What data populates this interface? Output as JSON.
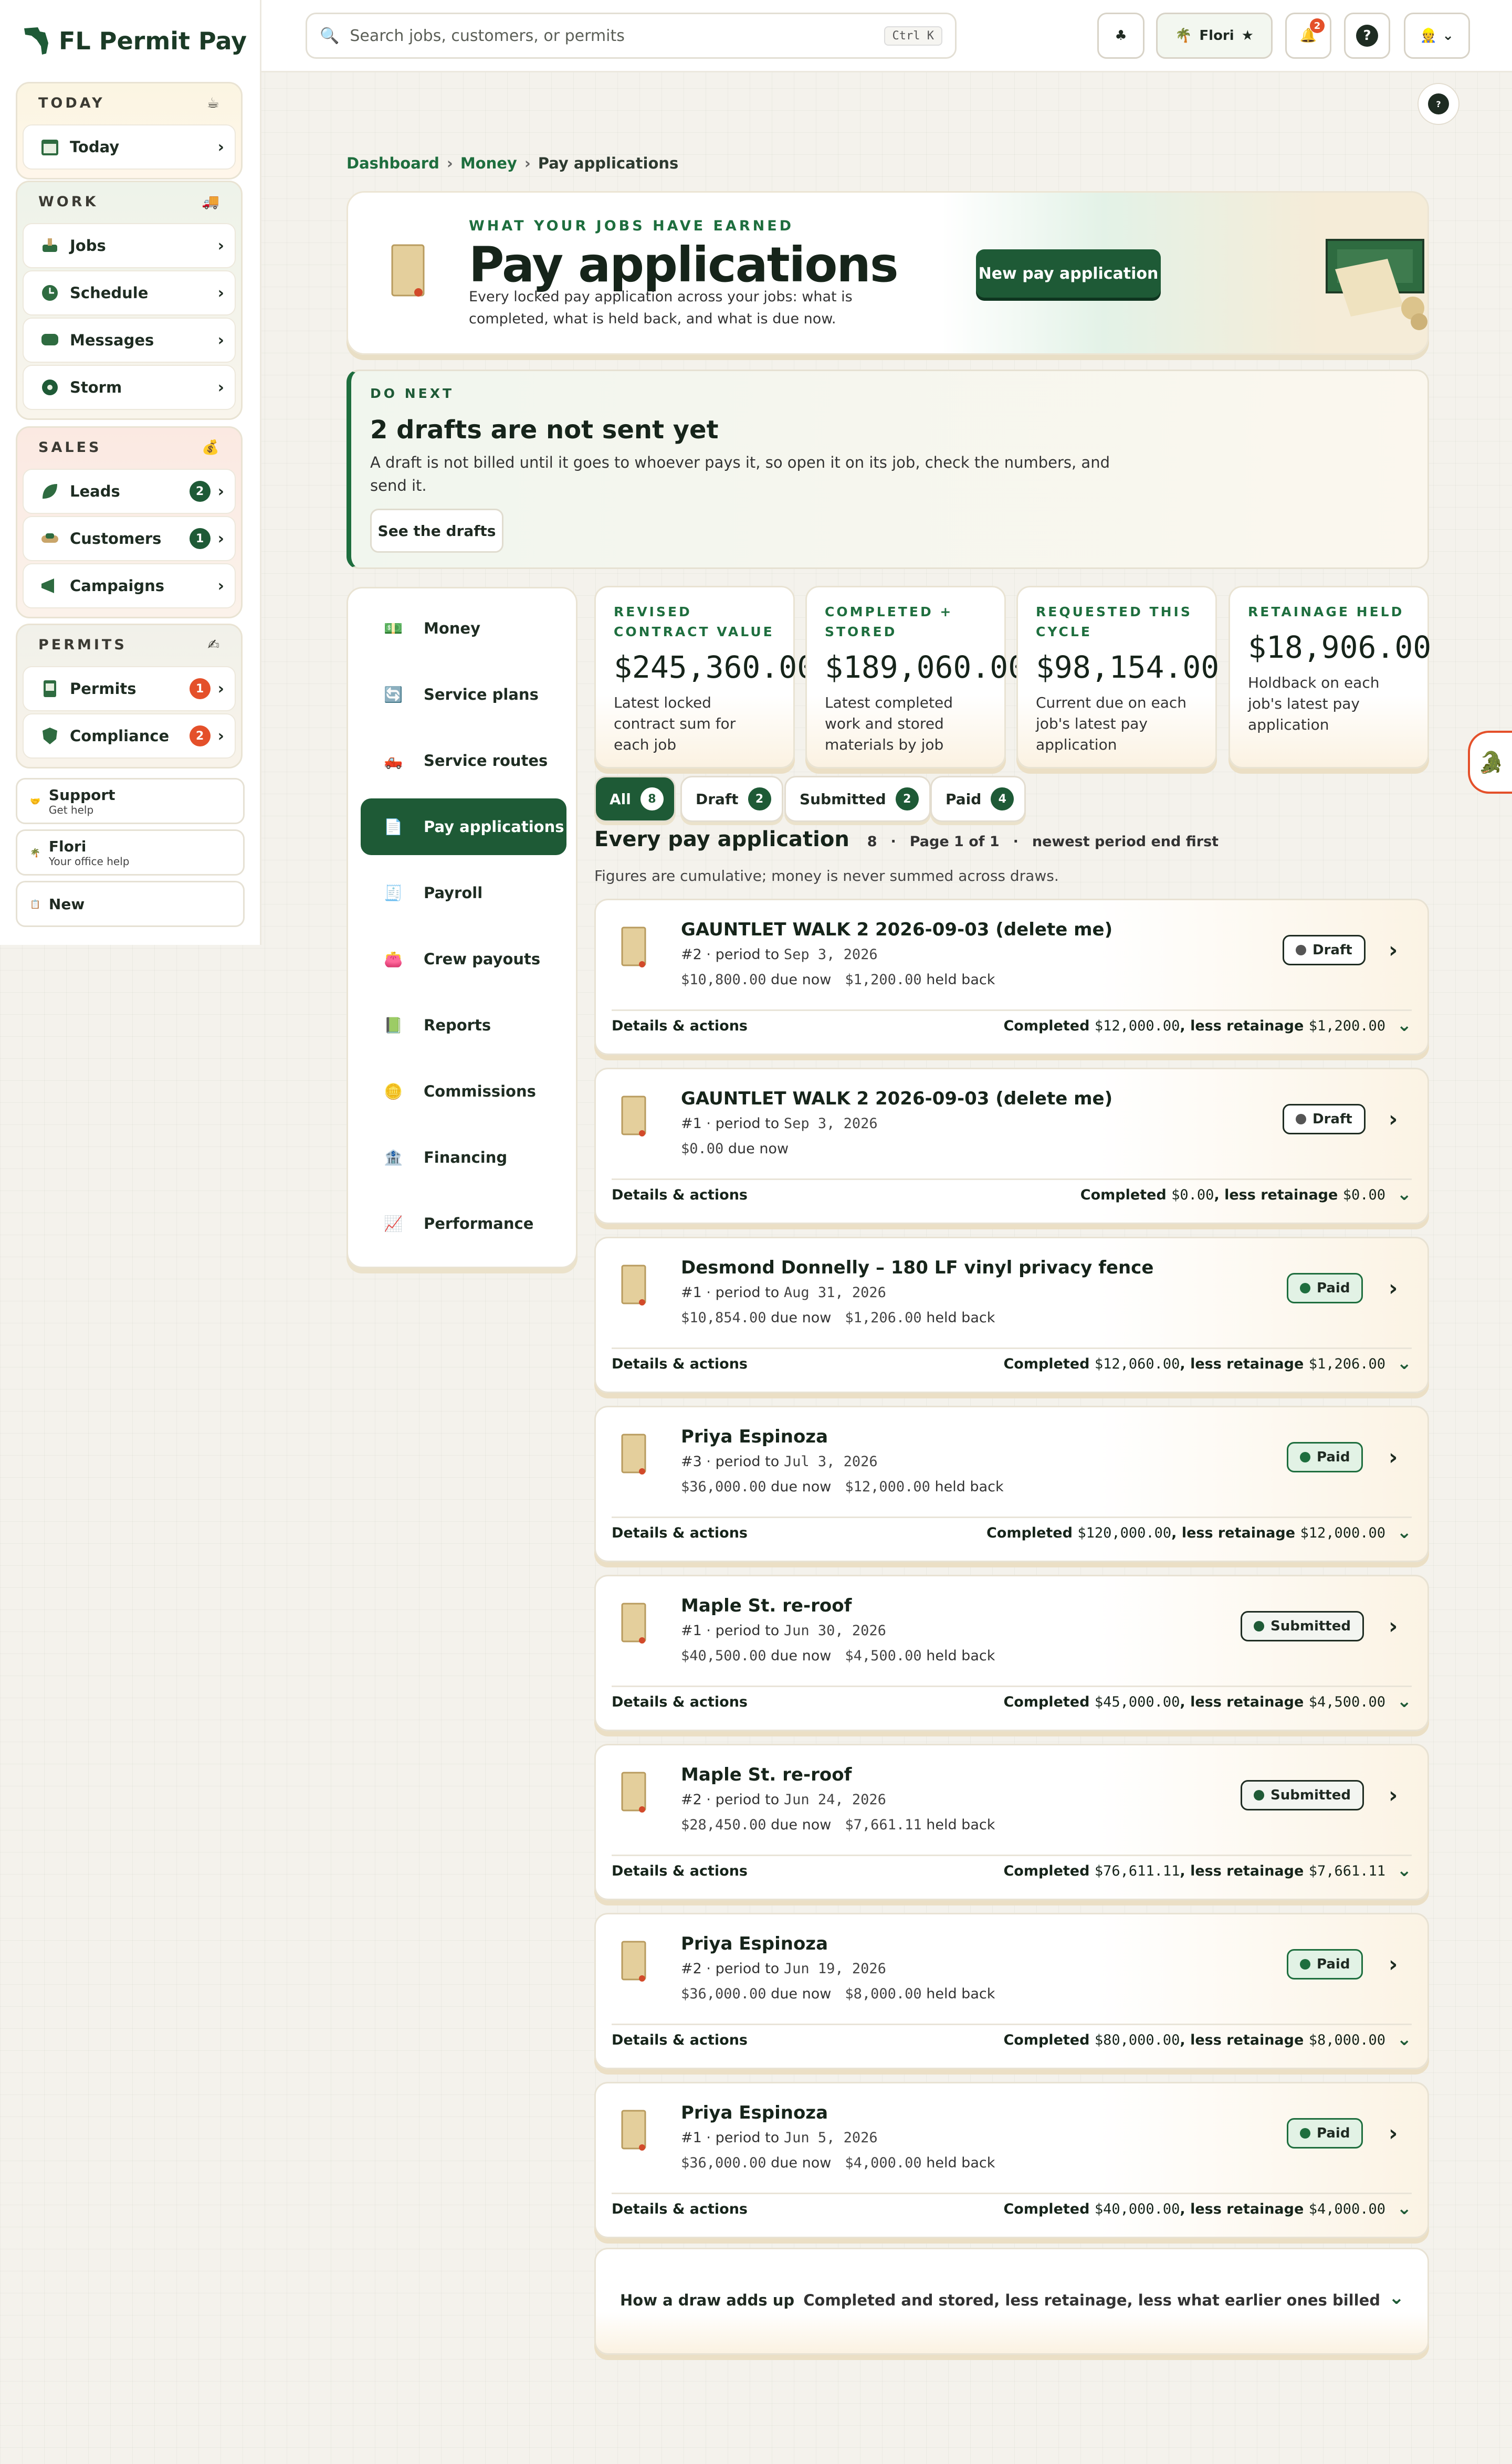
{
  "app": {
    "name": "FL Permit Pay"
  },
  "sidebar": {
    "groups": [
      {
        "title": "TODAY",
        "items": [
          {
            "label": "Today"
          }
        ]
      },
      {
        "title": "WORK",
        "items": [
          {
            "label": "Jobs"
          },
          {
            "label": "Schedule"
          },
          {
            "label": "Messages"
          },
          {
            "label": "Storm"
          }
        ]
      },
      {
        "title": "SALES",
        "items": [
          {
            "label": "Leads",
            "badge": "2"
          },
          {
            "label": "Customers",
            "badge": "1"
          },
          {
            "label": "Campaigns"
          }
        ]
      },
      {
        "title": "PERMITS",
        "items": [
          {
            "label": "Permits",
            "badge": "1"
          },
          {
            "label": "Compliance",
            "badge": "2"
          }
        ]
      }
    ],
    "support": {
      "title": "Support",
      "sub": "Get help"
    },
    "assistant": {
      "title": "Flori",
      "sub": "Your office help"
    },
    "new": {
      "label": "New"
    }
  },
  "topbar": {
    "search_placeholder": "Search jobs, customers, or permits",
    "shortcut": "Ctrl K",
    "flori_label": "Flori",
    "notif_count": "2",
    "help": "?"
  },
  "breadcrumb": {
    "items": [
      "Dashboard",
      "Money",
      "Pay applications"
    ],
    "sep": "›"
  },
  "hero": {
    "eyebrow": "WHAT YOUR JOBS HAVE EARNED",
    "title": "Pay applications",
    "desc": "Every locked pay application across your jobs: what is completed, what is held back, and what is due now.",
    "button": "New pay application"
  },
  "donext": {
    "eyebrow": "DO NEXT",
    "title": "2 drafts are not sent yet",
    "desc": "A draft is not billed until it goes to whoever pays it, so open it on its job, check the numbers, and send it.",
    "button": "See the drafts"
  },
  "subnav": [
    "Money",
    "Service plans",
    "Service routes",
    "Pay applications",
    "Payroll",
    "Crew payouts",
    "Reports",
    "Commissions",
    "Financing",
    "Performance"
  ],
  "metrics": [
    {
      "label": "REVISED CONTRACT VALUE",
      "value": "$245,360.00",
      "note": "Latest locked contract sum for each job"
    },
    {
      "label": "COMPLETED + STORED",
      "value": "$189,060.00",
      "note": "Latest completed work and stored materials by job"
    },
    {
      "label": "REQUESTED THIS CYCLE",
      "value": "$98,154.00",
      "note": "Current due on each job's latest pay application"
    },
    {
      "label": "RETAINAGE HELD",
      "value": "$18,906.00",
      "note": "Holdback on each job's latest pay application"
    }
  ],
  "filters": [
    {
      "label": "All",
      "count": "8"
    },
    {
      "label": "Draft",
      "count": "2"
    },
    {
      "label": "Submitted",
      "count": "2"
    },
    {
      "label": "Paid",
      "count": "4"
    }
  ],
  "list": {
    "title": "Every pay application",
    "count": "8",
    "page": "Page 1 of 1",
    "sort": "newest period end first",
    "subtitle": "Figures are cumulative; money is never summed across draws."
  },
  "common": {
    "period_to": "period to",
    "due_now": "due now",
    "held_back": "held back",
    "details": "Details & actions",
    "completed": "Completed",
    "less_ret": "less retainage"
  },
  "payapps": [
    {
      "title": "GAUNTLET WALK 2 2026-09-03 (delete me)",
      "num": "#2",
      "date": "Sep 3, 2026",
      "due": "$10,800.00",
      "held": "$1,200.00",
      "status": "Draft",
      "completed": "$12,000.00",
      "retainage": "$1,200.00"
    },
    {
      "title": "GAUNTLET WALK 2 2026-09-03 (delete me)",
      "num": "#1",
      "date": "Sep 3, 2026",
      "due": "$0.00",
      "held": "",
      "status": "Draft",
      "completed": "$0.00",
      "retainage": "$0.00"
    },
    {
      "title": "Desmond Donnelly – 180 LF vinyl privacy fence",
      "num": "#1",
      "date": "Aug 31, 2026",
      "due": "$10,854.00",
      "held": "$1,206.00",
      "status": "Paid",
      "completed": "$12,060.00",
      "retainage": "$1,206.00"
    },
    {
      "title": "Priya Espinoza",
      "num": "#3",
      "date": "Jul 3, 2026",
      "due": "$36,000.00",
      "held": "$12,000.00",
      "status": "Paid",
      "completed": "$120,000.00",
      "retainage": "$12,000.00"
    },
    {
      "title": "Maple St. re-roof",
      "num": "#1",
      "date": "Jun 30, 2026",
      "due": "$40,500.00",
      "held": "$4,500.00",
      "status": "Submitted",
      "completed": "$45,000.00",
      "retainage": "$4,500.00"
    },
    {
      "title": "Maple St. re-roof",
      "num": "#2",
      "date": "Jun 24, 2026",
      "due": "$28,450.00",
      "held": "$7,661.11",
      "status": "Submitted",
      "completed": "$76,611.11",
      "retainage": "$7,661.11"
    },
    {
      "title": "Priya Espinoza",
      "num": "#2",
      "date": "Jun 19, 2026",
      "due": "$36,000.00",
      "held": "$8,000.00",
      "status": "Paid",
      "completed": "$80,000.00",
      "retainage": "$8,000.00"
    },
    {
      "title": "Priya Espinoza",
      "num": "#1",
      "date": "Jun 5, 2026",
      "due": "$36,000.00",
      "held": "$4,000.00",
      "status": "Paid",
      "completed": "$40,000.00",
      "retainage": "$4,000.00"
    }
  ],
  "howto": {
    "title": "How a draw adds up",
    "desc": "Completed and stored, less retainage, less what earlier ones billed"
  },
  "colors": {
    "brand": "#1e5a36",
    "accent": "#1e6e3e",
    "danger": "#e4502a"
  }
}
